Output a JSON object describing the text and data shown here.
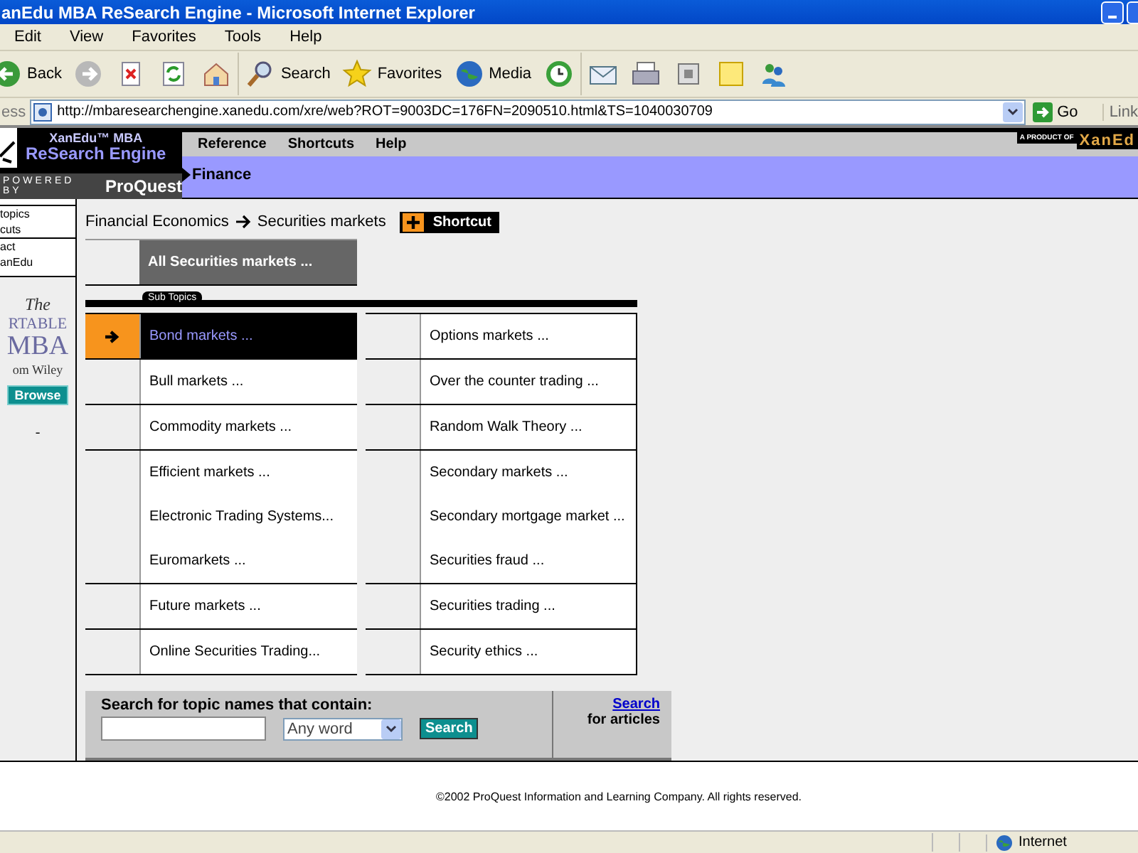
{
  "window": {
    "title": "anEdu MBA ReSearch Engine - Microsoft Internet Explorer"
  },
  "menu": [
    "Edit",
    "View",
    "Favorites",
    "Tools",
    "Help"
  ],
  "toolbar": [
    {
      "kind": "back",
      "label": "Back"
    },
    {
      "kind": "forward"
    },
    {
      "kind": "stop"
    },
    {
      "kind": "refresh"
    },
    {
      "kind": "home"
    },
    {
      "kind": "search",
      "label": "Search"
    },
    {
      "kind": "favorites",
      "label": "Favorites"
    },
    {
      "kind": "media",
      "label": "Media"
    },
    {
      "kind": "history"
    },
    {
      "kind": "mail"
    },
    {
      "kind": "print"
    },
    {
      "kind": "edit"
    },
    {
      "kind": "note"
    },
    {
      "kind": "messenger"
    }
  ],
  "address": {
    "label": "ess",
    "url": "http://mbaresearchengine.xanedu.com/xre/web?ROT=9003DC=176FN=2090510.html&TS=1040030709",
    "go": "Go",
    "links": "Link"
  },
  "site": {
    "logo_line1": "XanEdu™ MBA",
    "logo_line2": "ReSearch Engine",
    "powered": "POWERED BY",
    "proquest": "ProQuest",
    "nav": [
      "Reference",
      "Shortcuts",
      "Help"
    ],
    "section": "Finance",
    "product_of": "A PRODUCT OF",
    "brand": "XanEd"
  },
  "sidebar": {
    "links": [
      "topics",
      "cuts",
      "act",
      "anEdu"
    ],
    "ad": [
      "The",
      "RTABLE",
      "MBA",
      "om Wiley"
    ],
    "browse": "Browse",
    "dash": "-"
  },
  "breadcrumb": [
    "Financial Economics",
    "Securities markets"
  ],
  "shortcut": "Shortcut",
  "all_topics": "All Securities markets ...",
  "subtopics_label": "Sub Topics",
  "columns": [
    [
      [
        {
          "label": "Bond markets ...",
          "selected": true
        }
      ],
      [
        {
          "label": "Bull markets ...",
          "selected": false
        }
      ],
      [
        {
          "label": "Commodity markets ...",
          "selected": false
        }
      ],
      [
        {
          "label": "Efficient markets ...",
          "selected": false
        },
        {
          "label": "Electronic Trading Systems...",
          "selected": false
        },
        {
          "label": "Euromarkets ...",
          "selected": false
        }
      ],
      [
        {
          "label": "Future markets ...",
          "selected": false
        }
      ],
      [
        {
          "label": "Online Securities Trading...",
          "selected": false
        }
      ]
    ],
    [
      [
        {
          "label": "Options markets ...",
          "selected": false
        }
      ],
      [
        {
          "label": "Over the counter trading ...",
          "selected": false
        }
      ],
      [
        {
          "label": "Random Walk Theory ...",
          "selected": false
        }
      ],
      [
        {
          "label": "Secondary markets ...",
          "selected": false
        },
        {
          "label": "Secondary mortgage market ...",
          "selected": false
        },
        {
          "label": "Securities fraud ...",
          "selected": false
        }
      ],
      [
        {
          "label": "Securities trading ...",
          "selected": false
        }
      ],
      [
        {
          "label": "Security ethics ...",
          "selected": false
        }
      ]
    ]
  ],
  "search": {
    "label": "Search for topic names that contain:",
    "mode": "Any word",
    "button": "Search",
    "link": "Search",
    "link_rest": "for articles"
  },
  "footer": "©2002 ProQuest Information and Learning Company. All rights reserved.",
  "status": {
    "zone": "Internet"
  }
}
